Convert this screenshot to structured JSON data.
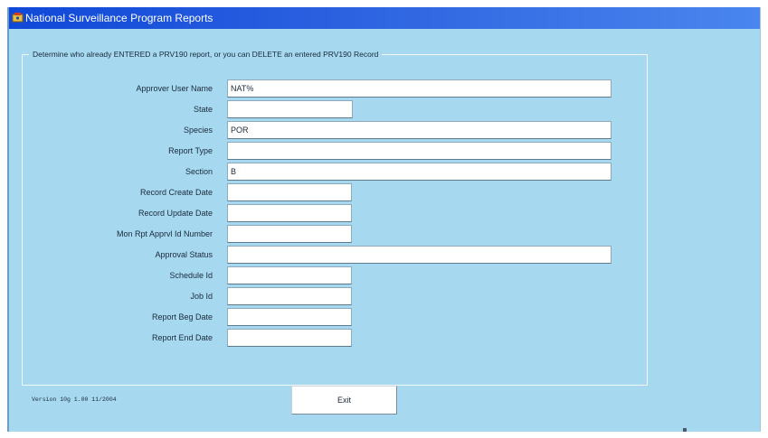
{
  "window": {
    "title": "National Surveillance Program Reports"
  },
  "form": {
    "group_title": "Determine who already ENTERED a PRV190 report, or you can DELETE an entered PRV190 Record",
    "fields": [
      {
        "label": "Approver User Name",
        "value": "NAT%"
      },
      {
        "label": "State",
        "value": ""
      },
      {
        "label": "Species",
        "value": "POR"
      },
      {
        "label": "Report Type",
        "value": ""
      },
      {
        "label": "Section",
        "value": "B"
      },
      {
        "label": "Record Create Date",
        "value": ""
      },
      {
        "label": "Record Update Date",
        "value": ""
      },
      {
        "label": "Mon Rpt Apprvl Id Number",
        "value": ""
      },
      {
        "label": "Approval Status",
        "value": ""
      },
      {
        "label": "Schedule Id",
        "value": ""
      },
      {
        "label": "Job Id",
        "value": ""
      },
      {
        "label": "Report Beg Date",
        "value": ""
      },
      {
        "label": "Report End Date",
        "value": ""
      }
    ]
  },
  "footer": {
    "version": "Version 10g 1.00 11/2004",
    "exit_label": "Exit"
  },
  "colors": {
    "background": "#a6d8f0",
    "titlebar": "#1048d8",
    "input": "#ffffff"
  }
}
